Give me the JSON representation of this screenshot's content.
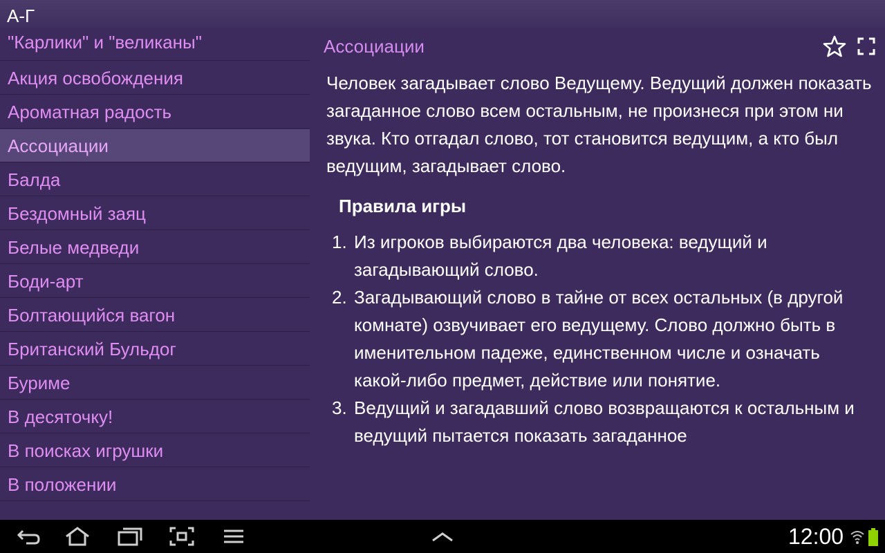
{
  "header": {
    "title": "А-Г"
  },
  "sidebar": {
    "items": [
      {
        "label": "\"Карлики\" и \"великаны\""
      },
      {
        "label": "Акция освобождения"
      },
      {
        "label": "Ароматная радость"
      },
      {
        "label": "Ассоциации",
        "selected": true
      },
      {
        "label": "Балда"
      },
      {
        "label": "Бездомный заяц"
      },
      {
        "label": "Белые медведи"
      },
      {
        "label": "Боди-арт"
      },
      {
        "label": "Болтающийся вагон"
      },
      {
        "label": "Британский Бульдог"
      },
      {
        "label": "Буриме"
      },
      {
        "label": "В десяточку!"
      },
      {
        "label": "В поисках игрушки"
      },
      {
        "label": "В положении"
      }
    ]
  },
  "content": {
    "title": "Ассоциации",
    "intro": "Человек загадывает слово Ведущему. Ведущий должен показать загаданное слово всем остальным, не произнеся при этом ни звука. Кто отгадал слово, тот становится ведущим, а кто был ведущим, загадывает слово.",
    "rules_heading": "Правила игры",
    "rules": [
      {
        "num": "1.",
        "text": "Из игроков выбираются два человека: ведущий и загадывающий слово."
      },
      {
        "num": "2.",
        "text": "Загадывающий слово в тайне от всех остальных (в другой комнате) озвучивает его ведущему. Слово должно быть в именительном падеже, единственном числе и означать какой-либо предмет, действие или понятие."
      },
      {
        "num": "3.",
        "text": "Ведущий и загадавший слово возвращаются к остальным и ведущий пытается показать загаданное"
      }
    ],
    "icons": {
      "favorite": "star-icon",
      "fullscreen": "fullscreen-icon"
    }
  },
  "statusbar": {
    "time": "12:00",
    "icons": [
      "back-icon",
      "home-icon",
      "recent-apps-icon",
      "screenshot-icon",
      "menu-icon",
      "chevron-up-icon",
      "wifi-icon",
      "battery-icon"
    ]
  },
  "colors": {
    "background": "#3c2b5c",
    "selected": "#574779",
    "link": "#e08df2",
    "navbar": "#000000",
    "battery": "#8fd400"
  }
}
